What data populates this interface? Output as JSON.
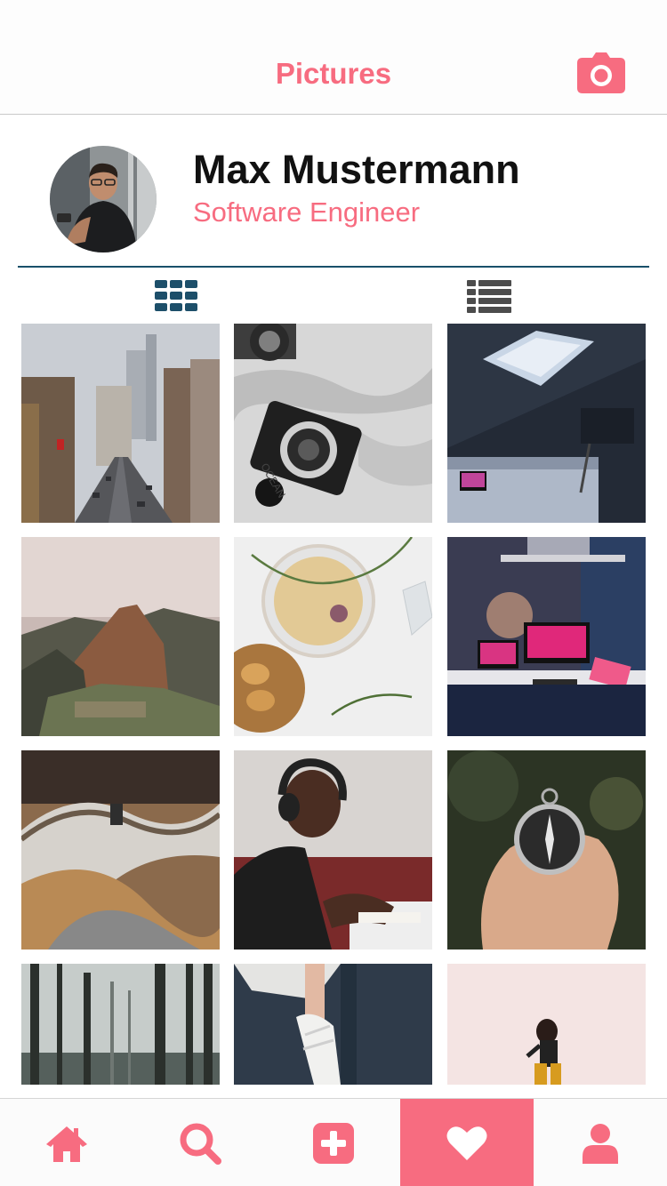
{
  "header": {
    "title": "Pictures",
    "camera_icon": "camera-icon"
  },
  "profile": {
    "name": "Max Mustermann",
    "role": "Software Engineer"
  },
  "view_toggle": {
    "selected": "grid",
    "icons": [
      "grid-icon",
      "list-icon"
    ]
  },
  "photos": [
    {
      "subject": "city-street",
      "row": 1,
      "col": 1
    },
    {
      "subject": "camera-on-map",
      "row": 1,
      "col": 2
    },
    {
      "subject": "attic-bedroom",
      "row": 1,
      "col": 3
    },
    {
      "subject": "machu-picchu",
      "row": 2,
      "col": 1
    },
    {
      "subject": "tea-and-cookies",
      "row": 2,
      "col": 2
    },
    {
      "subject": "desk-setup",
      "row": 2,
      "col": 3
    },
    {
      "subject": "library-shelves",
      "row": 3,
      "col": 1
    },
    {
      "subject": "man-with-headphones",
      "row": 3,
      "col": 2
    },
    {
      "subject": "hand-with-compass",
      "row": 3,
      "col": 3
    },
    {
      "subject": "misty-forest",
      "row": 4,
      "col": 1
    },
    {
      "subject": "ballet-shoes",
      "row": 4,
      "col": 2
    },
    {
      "subject": "woman-on-pink",
      "row": 4,
      "col": 3
    }
  ],
  "tabbar": {
    "active": "favorites",
    "tabs": [
      {
        "id": "home",
        "icon": "home-icon"
      },
      {
        "id": "search",
        "icon": "search-icon"
      },
      {
        "id": "add",
        "icon": "add-icon"
      },
      {
        "id": "favorites",
        "icon": "heart-icon"
      },
      {
        "id": "profile",
        "icon": "user-icon"
      }
    ]
  },
  "colors": {
    "accent": "#f76c80",
    "divider": "#19506a",
    "icon_dark": "#1d4f6a",
    "icon_gray": "#4c4c4c"
  }
}
